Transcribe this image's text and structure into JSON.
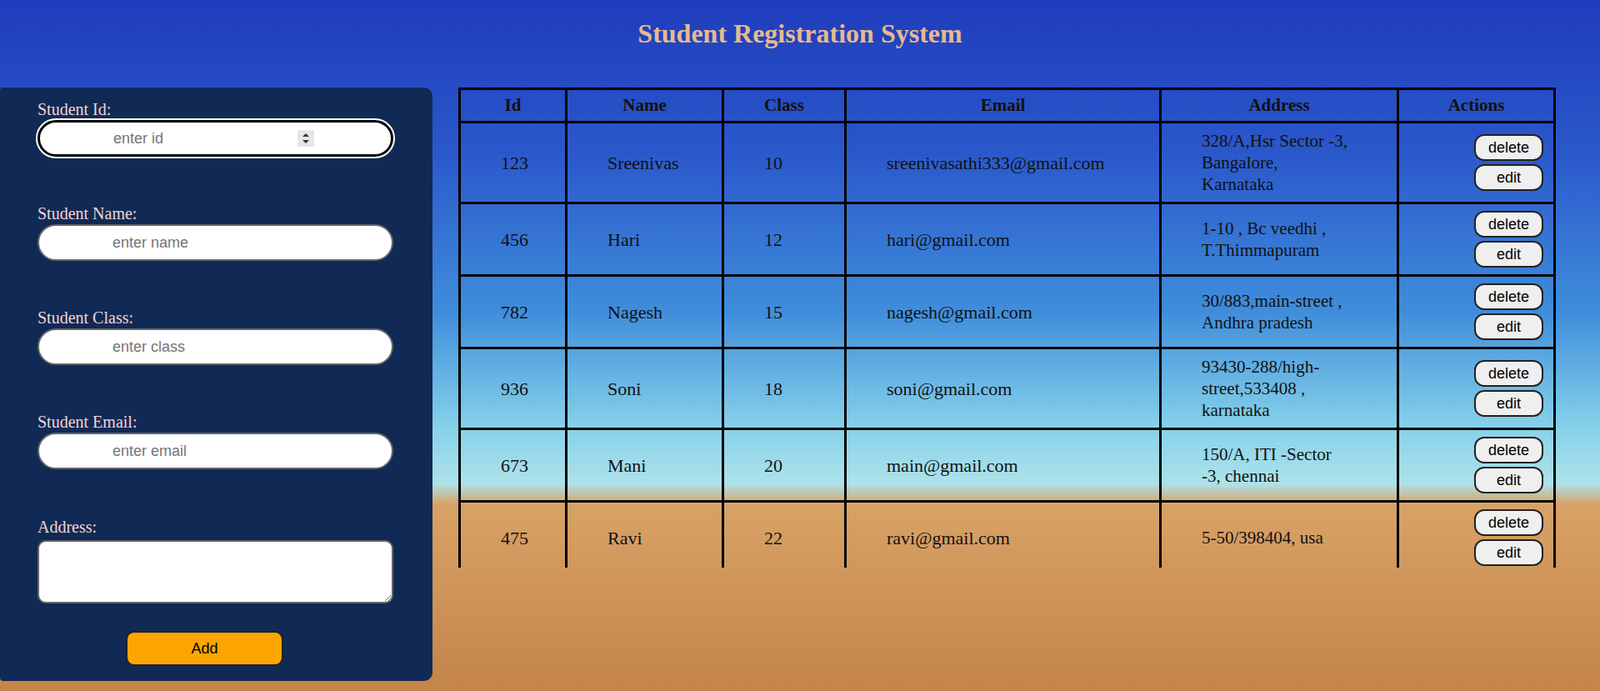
{
  "window": {
    "title": "Student Registration System"
  },
  "form": {
    "fields": [
      {
        "label": "Student Id:",
        "placeholder": "enter id",
        "kind": "number",
        "focused": true
      },
      {
        "label": "Student Name:",
        "placeholder": "enter name",
        "kind": "text",
        "focused": false
      },
      {
        "label": "Student Class:",
        "placeholder": "enter class",
        "kind": "text",
        "focused": false
      },
      {
        "label": "Student Email:",
        "placeholder": "enter email",
        "kind": "text",
        "focused": false
      },
      {
        "label": "Address:",
        "placeholder": "",
        "kind": "textarea",
        "focused": false
      }
    ],
    "submit": "Add"
  },
  "table": {
    "columns": [
      "Id",
      "Name",
      "Class",
      "Email",
      "Address",
      "Actions"
    ],
    "rows": [
      {
        "id": "123",
        "name": "Sreenivas",
        "class": "10",
        "email": "sreenivasathi333@gmail.com",
        "address": "328/A,Hsr Sector -3, Bangalore, Karnataka",
        "actions": [
          "delete",
          "edit"
        ]
      },
      {
        "id": "456",
        "name": "Hari",
        "class": "12",
        "email": "hari@gmail.com",
        "address": "1-10 , Bc veedhi , T.Thimmapuram",
        "actions": [
          "delete",
          "edit"
        ]
      },
      {
        "id": "782",
        "name": "Nagesh",
        "class": "15",
        "email": "nagesh@gmail.com",
        "address": "30/883,main-street , Andhra pradesh",
        "actions": [
          "delete",
          "edit"
        ]
      },
      {
        "id": "936",
        "name": "Soni",
        "class": "18",
        "email": "soni@gmail.com",
        "address": "93430-288/high-street,533408 , karnataka",
        "actions": [
          "delete",
          "edit"
        ]
      },
      {
        "id": "673",
        "name": "Mani",
        "class": "20",
        "email": "main@gmail.com",
        "address": "150/A, ITI -Sector -3, chennai",
        "actions": [
          "delete",
          "edit"
        ]
      },
      {
        "id": "475",
        "name": "Ravi",
        "class": "22",
        "email": "ravi@gmail.com",
        "address": "5-50/398404, usa",
        "actions": [
          "delete",
          "edit"
        ]
      }
    ]
  }
}
